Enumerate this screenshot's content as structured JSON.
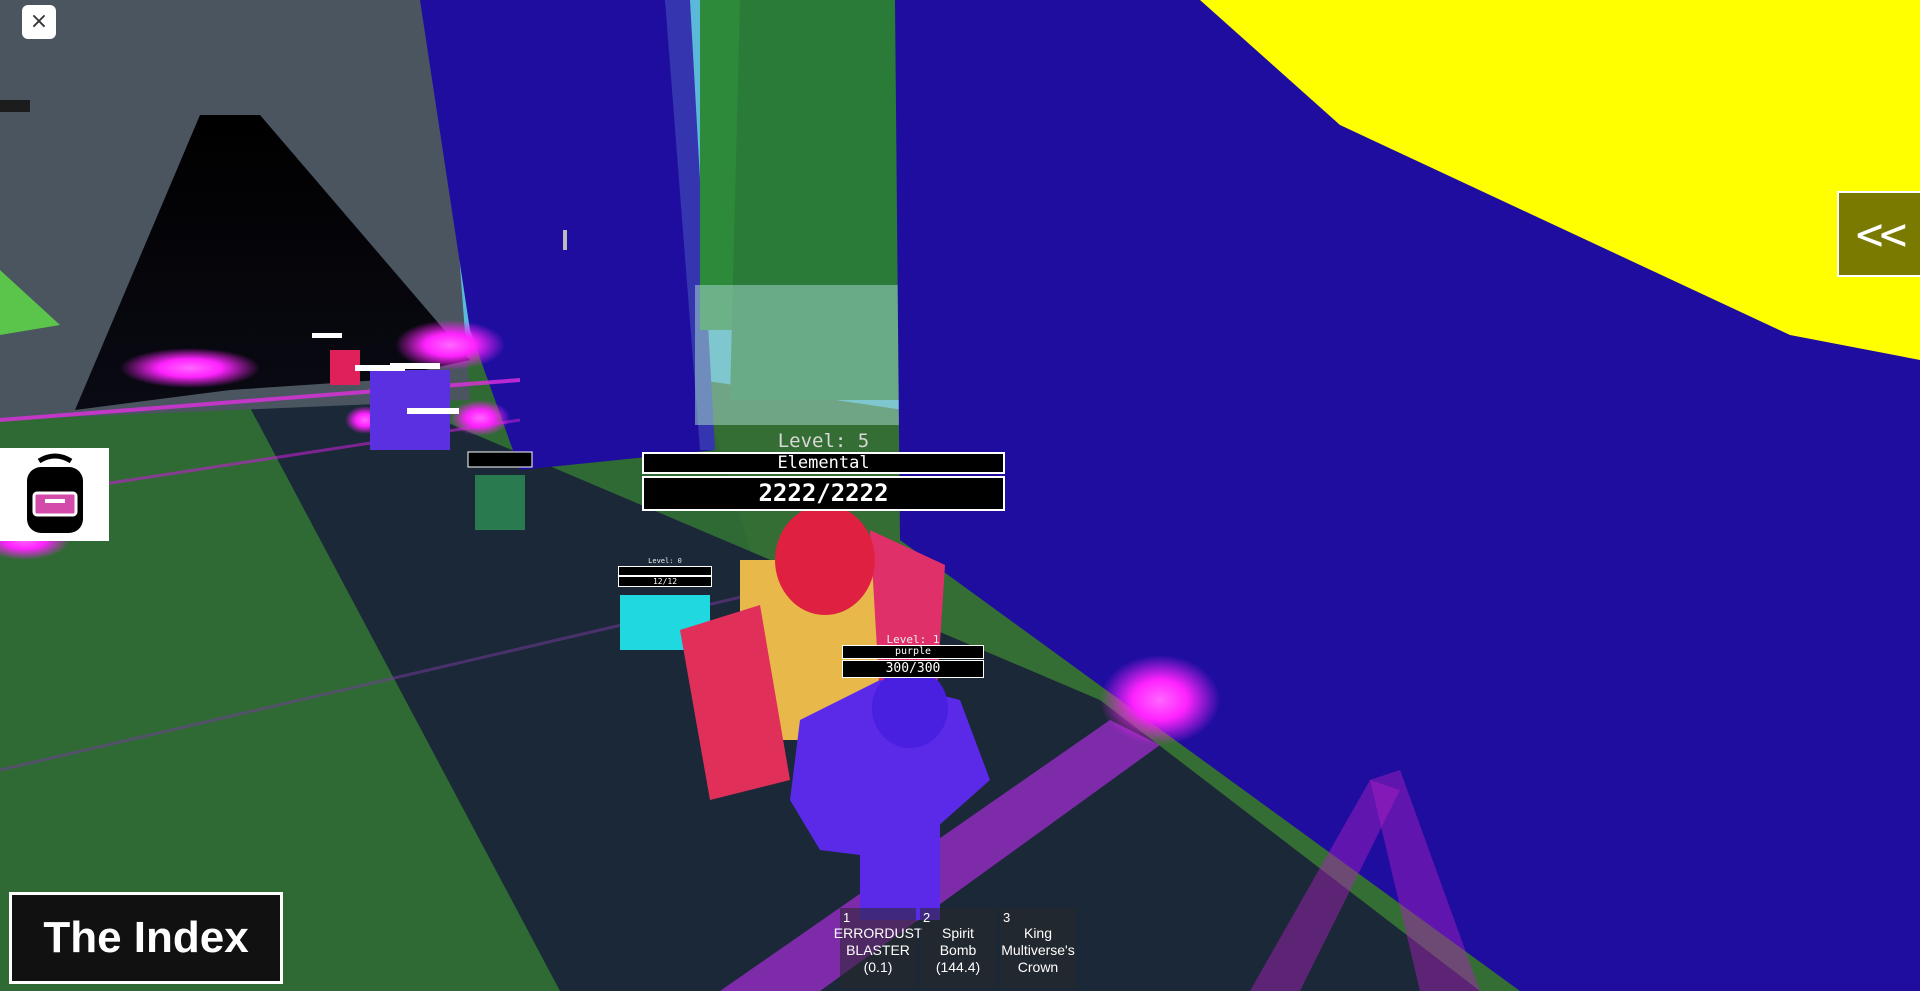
{
  "hud": {
    "close_icon": "×",
    "collapse_label": "<<",
    "index_label": "The Index",
    "backpack_icon": "backpack-icon"
  },
  "nameplates": {
    "main": {
      "level": "Level: 5",
      "name": "Elemental",
      "health": "2222/2222"
    },
    "purple": {
      "level": "Level: 1",
      "name": "purple",
      "health": "300/300"
    },
    "cyan": {
      "level": "Level: 0",
      "health": "12/12"
    }
  },
  "hotbar": [
    {
      "num": "1",
      "label": "ERRORDUST BLASTER (0.1)"
    },
    {
      "num": "2",
      "label": "Spirit Bomb (144.4)"
    },
    {
      "num": "3",
      "label": "King Multiverse's Crown"
    }
  ],
  "colors": {
    "sky": "#5ab8d8",
    "wall_blue": "#1f0da0",
    "yellow": "#ffff00",
    "grass": "#2f6a34",
    "road": "#1b2838",
    "neon": "#ff22ff",
    "hotbar_bg": "#282828"
  }
}
